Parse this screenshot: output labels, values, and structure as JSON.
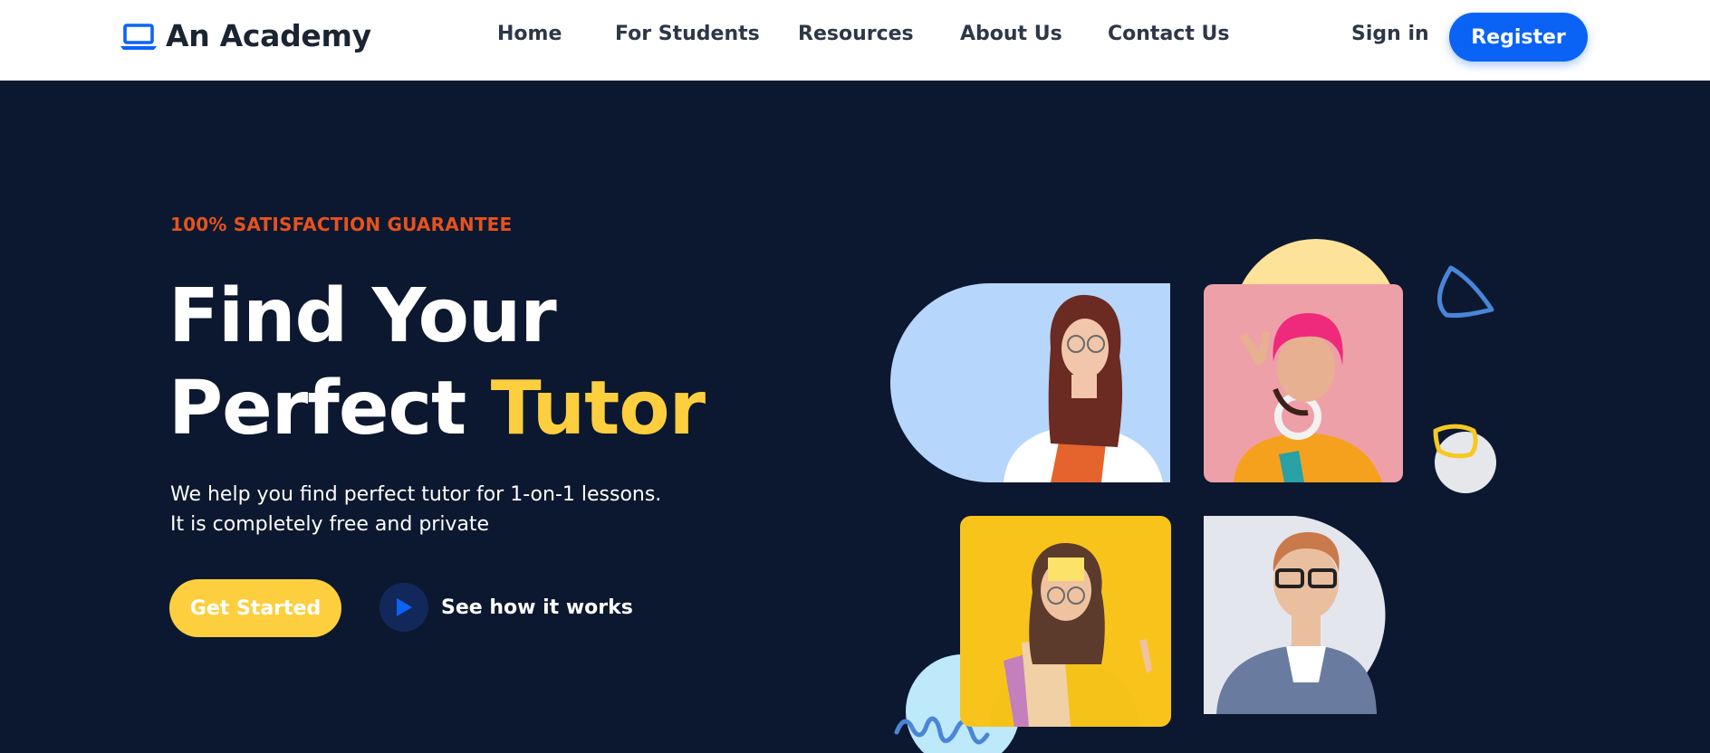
{
  "brand": {
    "name": "An Academy",
    "icon": "laptop-icon"
  },
  "nav": {
    "links": [
      {
        "label": "Home"
      },
      {
        "label": "For Students"
      },
      {
        "label": "Resources"
      },
      {
        "label": "About Us"
      },
      {
        "label": "Contact Us"
      }
    ],
    "signin_label": "Sign in",
    "register_label": "Register"
  },
  "hero": {
    "eyebrow": "100% SATISFACTION GUARANTEE",
    "headline_line1": "Find Your",
    "headline_line2_prefix": "Perfect ",
    "headline_line2_accent": "Tutor",
    "description": "We help you find perfect tutor for 1-on-1 lessons. It is completely free and private",
    "cta_label": "Get Started",
    "secondary_label": "See how it works",
    "secondary_icon": "play-icon"
  },
  "collage": {
    "photos": [
      {
        "subject": "student-with-notebooks",
        "background": "#b7d6fb"
      },
      {
        "subject": "student-pink-beanie",
        "background": "#eea0a8"
      },
      {
        "subject": "student-sticky-note",
        "background": "#f8c41c"
      },
      {
        "subject": "student-plaid-shirt",
        "background": "#e4e6ee"
      }
    ]
  },
  "colors": {
    "brand_blue": "#0b63f6",
    "accent_yellow": "#fdcf3e",
    "eyebrow_orange": "#e5521e",
    "hero_background": "#0c1830",
    "nav_text": "#2d3748"
  }
}
